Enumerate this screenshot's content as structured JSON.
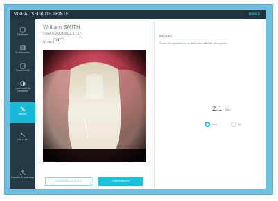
{
  "window": {
    "title": "VISUALISEUR DE TEINTE",
    "close_label": "FERMER"
  },
  "sidebar": {
    "items": [
      {
        "label": "Calibrage",
        "icon": "calibration-icon",
        "active": false
      },
      {
        "label": "Stratification",
        "icon": "layers-icon",
        "active": false
      },
      {
        "label": "Translucidité",
        "icon": "tooth-outline-icon",
        "active": false
      },
      {
        "label": "Luminosité & contraste",
        "icon": "contrast-icon",
        "active": false
      },
      {
        "label": "Mesure",
        "icon": "ruler-icon",
        "active": true
      },
      {
        "label": "Lab / Lch",
        "icon": "lab-icon",
        "active": false
      },
      {
        "label": "Exporter & imprimer",
        "icon": "export-icon",
        "active": false
      }
    ]
  },
  "patient": {
    "name": "William SMITH",
    "created": "Créée le 20/04/2022, 11:57",
    "tooth_label": "N° dent",
    "tooth_number": "21"
  },
  "buttons": {
    "delete": "SUPPRIMER LA TEINTE",
    "compare": "COMPARAISON"
  },
  "measure": {
    "title": "MESURE",
    "hint": "Tracer un segment sur la dent pour afficher sa longueur",
    "value": "2.1",
    "unit": "mm",
    "options": [
      {
        "label": "mm",
        "selected": true
      },
      {
        "label": "in",
        "selected": false
      }
    ]
  },
  "colors": {
    "accent": "#16b9d6",
    "sidebar": "#233946",
    "titlebar": "#1f3340"
  }
}
